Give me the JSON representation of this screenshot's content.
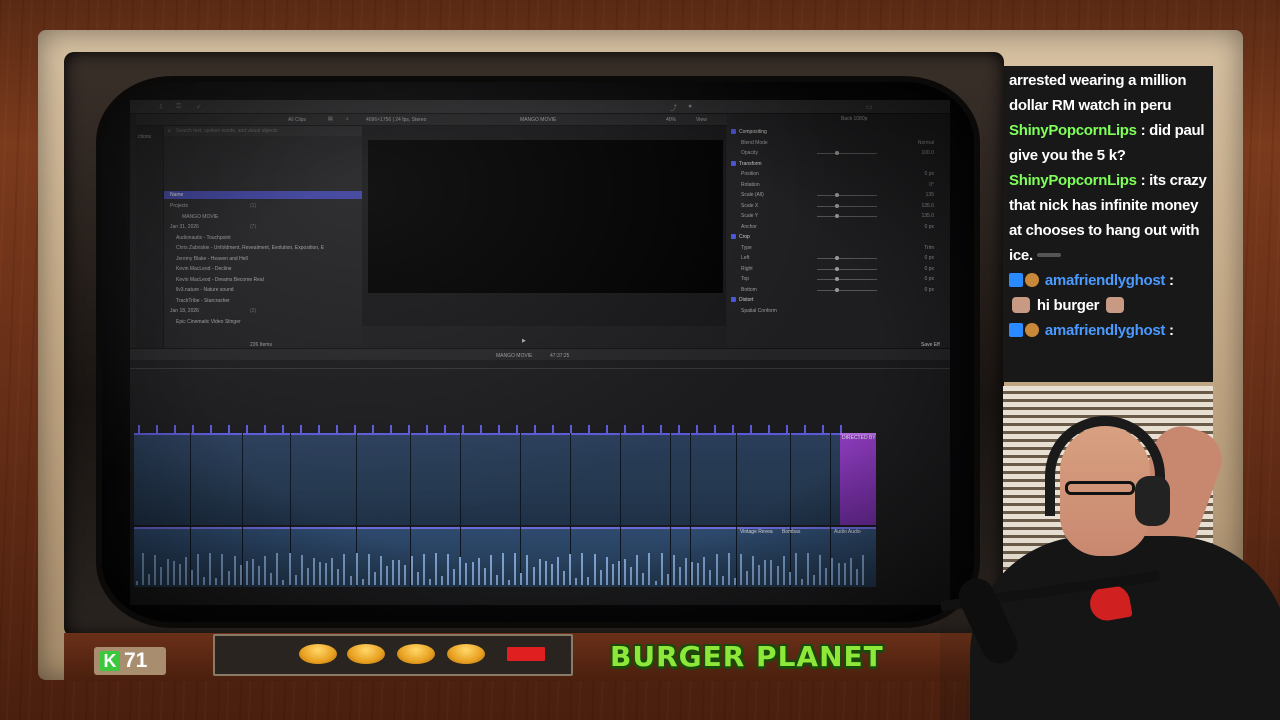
{
  "chat": {
    "messages": [
      {
        "user": "",
        "text": "arrested wearing a million dollar RM watch in peru"
      },
      {
        "user": "ShinyPopcornLips",
        "text": "did paul give you the 5 k?"
      },
      {
        "user": "ShinyPopcornLips",
        "text": "its crazy that nick has infinite money at chooses to hang out with ice."
      },
      {
        "user": "amafriendlyghost",
        "text": "hi burger"
      },
      {
        "user": "amafriendlyghost",
        "text": ""
      }
    ]
  },
  "counter": {
    "value": "71",
    "icon": "K"
  },
  "logo": {
    "text": "BURGER PLANET"
  },
  "app": {
    "all_clips": "All Clips",
    "format": "4096×1756 | 24 fps, Stereo",
    "project_title": "MANGO MOVIE",
    "zoom": "40%",
    "view": "View",
    "inspector_title": "Back 1080p",
    "search_placeholder": "Search text, spoken words, and visual objects",
    "library_label": "ctions",
    "name_header": "Name",
    "items_count": "226 Items",
    "timeline_title": "MANGO MOVIE",
    "timecode": "47:37:25",
    "save_label": "Save Eff"
  },
  "browser_rows": [
    {
      "indent": 1,
      "text": "Projects",
      "suffix": "(1)"
    },
    {
      "indent": 3,
      "text": "MANGO MOVIE",
      "suffix": ""
    },
    {
      "indent": 1,
      "text": "Jan 31, 2026",
      "suffix": "(7)"
    },
    {
      "indent": 2,
      "text": "Audionautix - Touchpoint",
      "suffix": ""
    },
    {
      "indent": 2,
      "text": "Chris Zabriskie - Unfoldment, Revealment, Evolution, Exposition, E",
      "suffix": ""
    },
    {
      "indent": 2,
      "text": "Jeremy Blake - Heaven and Hell",
      "suffix": ""
    },
    {
      "indent": 2,
      "text": "Kevin MacLeod - Decline",
      "suffix": ""
    },
    {
      "indent": 2,
      "text": "Kevin MacLeod - Dreams Become Real",
      "suffix": ""
    },
    {
      "indent": 2,
      "text": "llv3.nature - Nature sound",
      "suffix": ""
    },
    {
      "indent": 2,
      "text": "TrackTribe - Starcrasher",
      "suffix": ""
    },
    {
      "indent": 1,
      "text": "Jan 18, 2026",
      "suffix": "(2)"
    },
    {
      "indent": 2,
      "text": "Epic Cinematic Video Stinger",
      "suffix": ""
    }
  ],
  "inspector_rows": [
    {
      "label": "Compositing",
      "value": "",
      "section": true
    },
    {
      "label": "Blend Mode",
      "value": "Normal",
      "section": false
    },
    {
      "label": "Opacity",
      "value": "100.0",
      "section": false
    },
    {
      "label": "Transform",
      "value": "",
      "section": true
    },
    {
      "label": "Position",
      "value": "0 px",
      "section": false
    },
    {
      "label": "Rotation",
      "value": "0°",
      "section": false
    },
    {
      "label": "Scale (All)",
      "value": "135",
      "section": false
    },
    {
      "label": "Scale X",
      "value": "135.0",
      "section": false
    },
    {
      "label": "Scale Y",
      "value": "135.0",
      "section": false
    },
    {
      "label": "Anchor",
      "value": "0 px",
      "section": false
    },
    {
      "label": "Crop",
      "value": "",
      "section": true
    },
    {
      "label": "Type",
      "value": "Trim",
      "section": false
    },
    {
      "label": "Left",
      "value": "0 px",
      "section": false
    },
    {
      "label": "Right",
      "value": "0 px",
      "section": false
    },
    {
      "label": "Top",
      "value": "0 px",
      "section": false
    },
    {
      "label": "Bottom",
      "value": "0 px",
      "section": false
    },
    {
      "label": "Distort",
      "value": "",
      "section": true
    },
    {
      "label": "Spatial Conform",
      "value": "",
      "section": false
    }
  ],
  "clip_labels": [
    "Vintage Revea",
    "Bombas",
    "Audio Audio",
    "DIRECTED BY"
  ],
  "icons": {
    "k-icon": "K",
    "prime-badge": "crown",
    "burger-badge": "burger",
    "play-icon": "▶"
  },
  "colors": {
    "chat_user_green": "#7fff5a",
    "chat_user_blue": "#4a9aff",
    "logo_green": "#8ee83a",
    "fcp_selection": "#3a3e9a",
    "clip_purple": "#8a3ab8"
  }
}
